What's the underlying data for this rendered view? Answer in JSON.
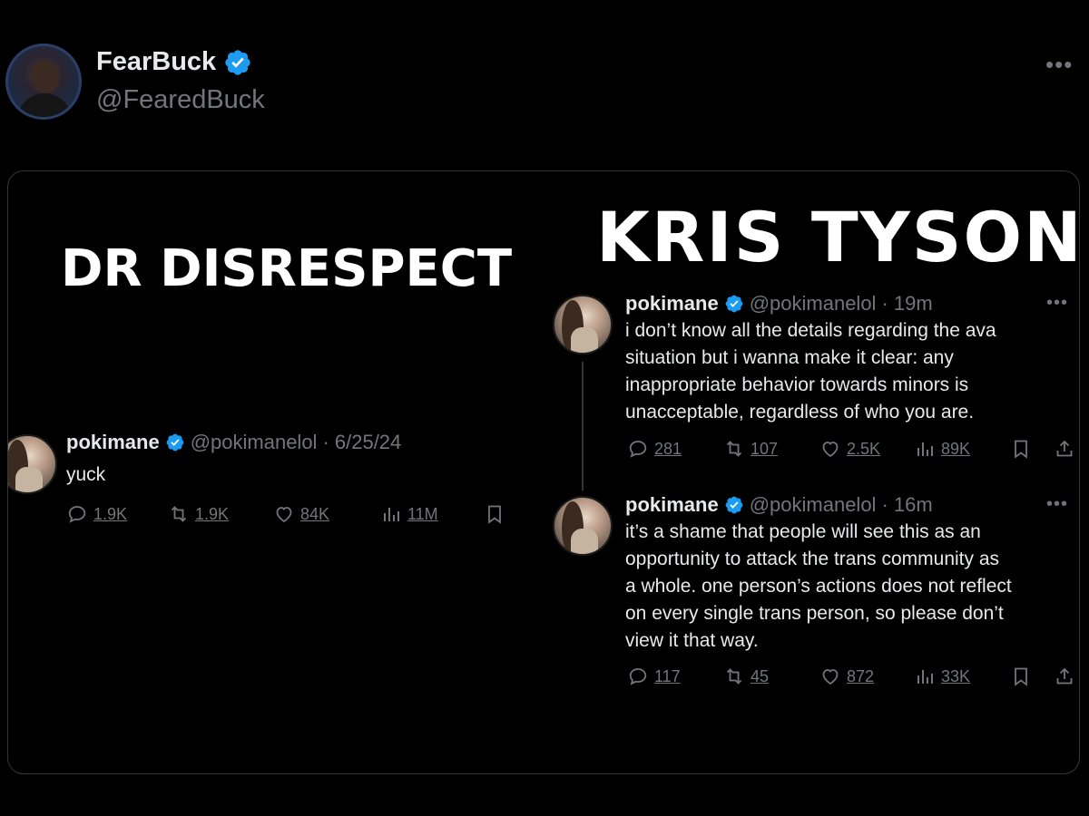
{
  "post": {
    "author_name": "FearBuck",
    "author_handle": "@FearedBuck",
    "more_glyph": "•••"
  },
  "media": {
    "left_title": "DR DISRESPECT",
    "right_title": "KRIS TYSON",
    "left_tweet": {
      "name": "pokimane",
      "handle": "@pokimanelol",
      "time": "· 6/25/24",
      "text": "yuck",
      "replies": "1.9K",
      "reposts": "1.9K",
      "likes": "84K",
      "views": "11M"
    },
    "right_tweets": [
      {
        "name": "pokimane",
        "handle": "@pokimanelol",
        "time": "· 19m",
        "text": "i don’t know all the details regarding the ava\nsituation but i wanna make it clear: any\ninappropriate behavior towards minors is\nunacceptable, regardless of who you are.",
        "replies": "281",
        "reposts": "107",
        "likes": "2.5K",
        "views": "89K"
      },
      {
        "name": "pokimane",
        "handle": "@pokimanelol",
        "time": "· 16m",
        "text": "it’s a shame that people will see this as an\nopportunity to attack the trans community as\na whole. one person’s actions does not reflect\non every single trans person, so please don’t\nview it that way.",
        "replies": "117",
        "reposts": "45",
        "likes": "872",
        "views": "33K"
      }
    ]
  },
  "colors": {
    "background": "#000000",
    "text": "#e7e9ea",
    "muted": "#71767b",
    "verified": "#1d9bf0",
    "border": "#333639"
  }
}
